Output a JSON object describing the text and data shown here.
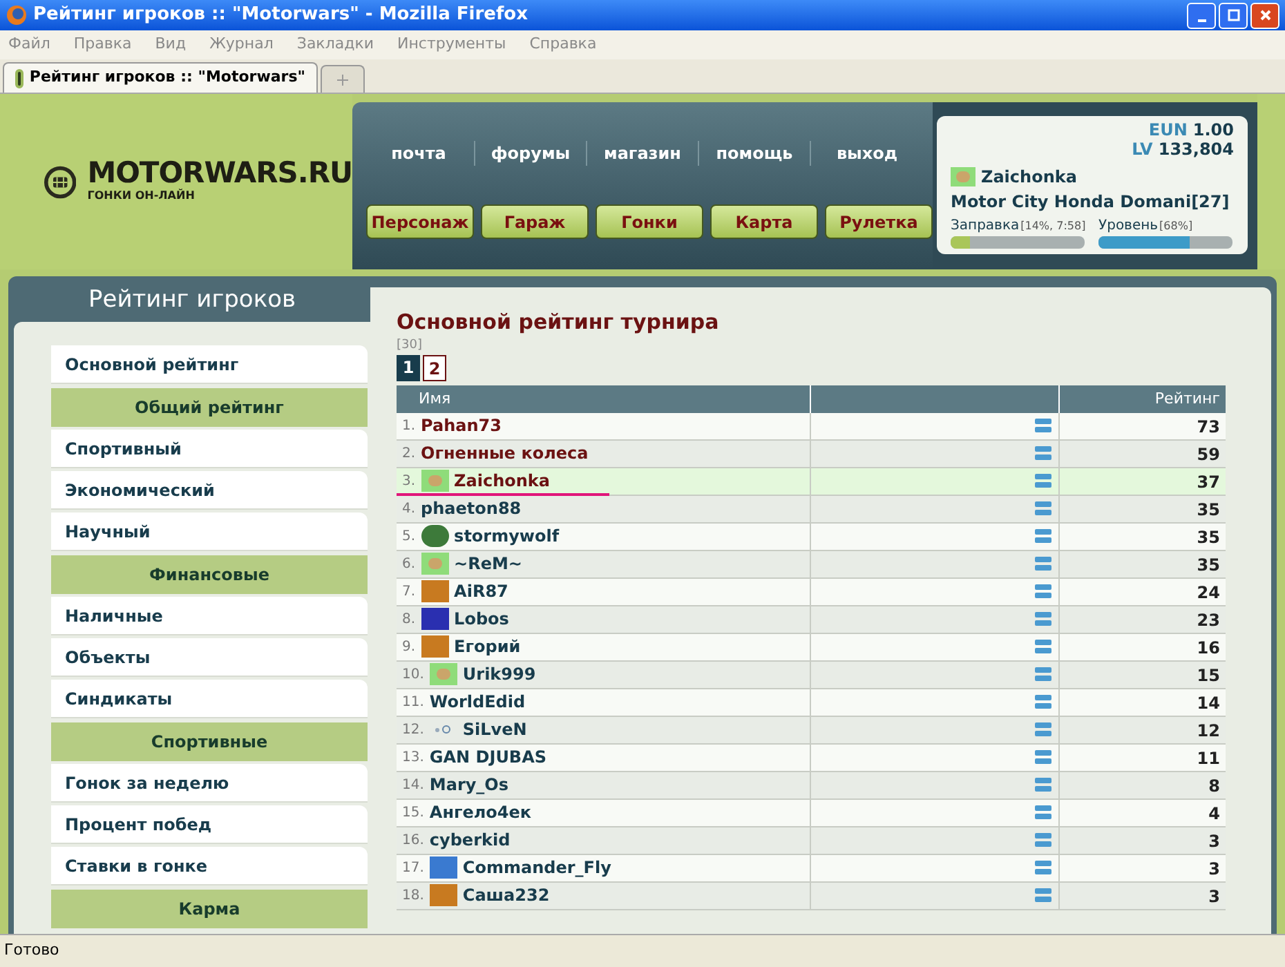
{
  "window": {
    "title": "Рейтинг игроков :: \"Motorwars\" - Mozilla Firefox"
  },
  "menu": [
    "Файл",
    "Правка",
    "Вид",
    "Журнал",
    "Закладки",
    "Инструменты",
    "Справка"
  ],
  "tabs": [
    {
      "label": "Рейтинг игроков :: \"Motorwars\"",
      "selected": true
    }
  ],
  "logo": {
    "name": "MOTORWARS.RU",
    "tagline": "ГОНКИ ОН-ЛАЙН"
  },
  "nav_links": [
    "почта",
    "форумы",
    "магазин",
    "помощь",
    "выход"
  ],
  "nav_buttons": [
    "Персонаж",
    "Гараж",
    "Гонки",
    "Карта",
    "Рулетка"
  ],
  "user_panel": {
    "eun_label": "EUN",
    "eun": "1.00",
    "lv_label": "LV",
    "lv": "133,804",
    "name": "Zaichonka",
    "car": "Motor City Honda Domani[27]",
    "meters": [
      {
        "label": "Заправка",
        "reading": "[14%, 7:58]",
        "level": 0.14,
        "kind": "fuel"
      },
      {
        "label": "Уровень",
        "reading": "[68%]",
        "level": 0.68,
        "kind": "xp"
      }
    ]
  },
  "sidebar": {
    "title": "Рейтинг игроков",
    "items": [
      {
        "kind": "link",
        "label": "Основной рейтинг"
      },
      {
        "kind": "header",
        "label": "Общий рейтинг"
      },
      {
        "kind": "link",
        "label": "Спортивный"
      },
      {
        "kind": "link",
        "label": "Экономический"
      },
      {
        "kind": "link",
        "label": "Научный"
      },
      {
        "kind": "header",
        "label": "Финансовые"
      },
      {
        "kind": "link",
        "label": "Наличные"
      },
      {
        "kind": "link",
        "label": "Объекты"
      },
      {
        "kind": "link",
        "label": "Синдикаты"
      },
      {
        "kind": "header",
        "label": "Спортивные"
      },
      {
        "kind": "link",
        "label": "Гонок за неделю"
      },
      {
        "kind": "link",
        "label": "Процент побед"
      },
      {
        "kind": "link",
        "label": "Ставки в гонке"
      },
      {
        "kind": "header",
        "label": "Карма"
      }
    ]
  },
  "content": {
    "title": "Основной рейтинг турнира",
    "count": "[30]",
    "pages": [
      {
        "label": "1",
        "selected": true
      },
      {
        "label": "2",
        "selected": false
      }
    ],
    "table": {
      "columns": [
        "Имя",
        "Рейтинг"
      ],
      "rows": [
        {
          "rank": "1.",
          "name": "Pahan73",
          "rating": "73",
          "color": "#6b1212",
          "selected": false
        },
        {
          "rank": "2.",
          "name": "Огненные колеса",
          "rating": "59",
          "color": "#6b1212",
          "selected": false
        },
        {
          "rank": "3.",
          "name": "Zaichonka",
          "rating": "37",
          "color": "#6b1212",
          "kind": "rabbit",
          "selected": true
        },
        {
          "rank": "4.",
          "name": "phaeton88",
          "rating": "35",
          "color": "#183c4c",
          "selected": false
        },
        {
          "rank": "5.",
          "name": "stormywolf",
          "rating": "35",
          "color": "#183c4c",
          "kind": "wolf",
          "selected": false
        },
        {
          "rank": "6.",
          "name": "~ReM~",
          "rating": "35",
          "color": "#183c4c",
          "kind": "rabbit",
          "selected": false
        },
        {
          "rank": "7.",
          "name": "AiR87",
          "rating": "24",
          "color": "#183c4c",
          "kind": "orange",
          "selected": false
        },
        {
          "rank": "8.",
          "name": "Lobos",
          "rating": "23",
          "color": "#183c4c",
          "kind": "blue",
          "selected": false
        },
        {
          "rank": "9.",
          "name": "Егорий",
          "rating": "16",
          "color": "#183c4c",
          "kind": "orange",
          "selected": false
        },
        {
          "rank": "10.",
          "name": "Urik999",
          "rating": "15",
          "color": "#183c4c",
          "kind": "rabbit",
          "selected": false
        },
        {
          "rank": "11.",
          "name": "WorldEdid",
          "rating": "14",
          "color": "#183c4c",
          "selected": false
        },
        {
          "rank": "12.",
          "name": "SiLveN",
          "rating": "12",
          "color": "#183c4c",
          "kind": "dots",
          "selected": false
        },
        {
          "rank": "13.",
          "name": "GAN DJUBAS",
          "rating": "11",
          "color": "#183c4c",
          "selected": false
        },
        {
          "rank": "14.",
          "name": "Mary_Os",
          "rating": "8",
          "color": "#183c4c",
          "selected": false
        },
        {
          "rank": "15.",
          "name": "Ангело4ек",
          "rating": "4",
          "color": "#183c4c",
          "selected": false
        },
        {
          "rank": "16.",
          "name": "cyberkid",
          "rating": "3",
          "color": "#183c4c",
          "selected": false
        },
        {
          "rank": "17.",
          "name": "Commander_Fly",
          "rating": "3",
          "color": "#183c4c",
          "kind": "sky",
          "selected": false
        },
        {
          "rank": "18.",
          "name": "Саша232",
          "rating": "3",
          "color": "#183c4c",
          "kind": "orange",
          "selected": false
        }
      ]
    }
  },
  "status_bar": "Готово"
}
